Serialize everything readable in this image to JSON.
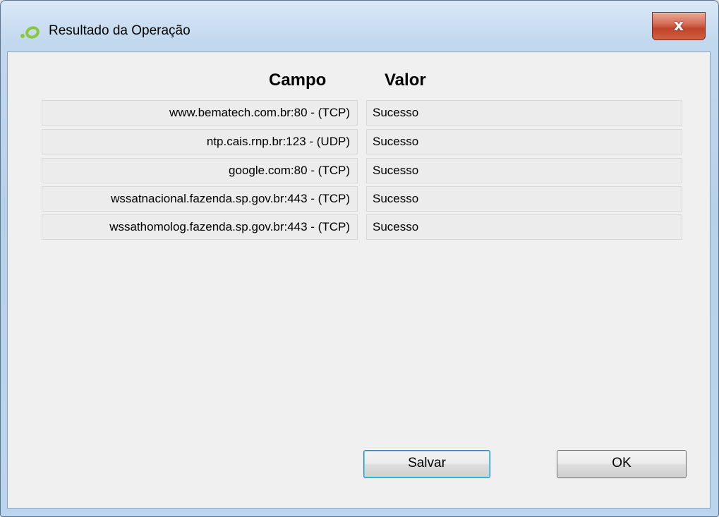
{
  "window": {
    "title": "Resultado da Operação",
    "close_label": "x"
  },
  "table": {
    "headers": {
      "campo": "Campo",
      "valor": "Valor"
    },
    "rows": [
      {
        "campo": "www.bematech.com.br:80 - (TCP)",
        "valor": "Sucesso"
      },
      {
        "campo": "ntp.cais.rnp.br:123 - (UDP)",
        "valor": "Sucesso"
      },
      {
        "campo": "google.com:80 - (TCP)",
        "valor": "Sucesso"
      },
      {
        "campo": "wssatnacional.fazenda.sp.gov.br:443 - (TCP)",
        "valor": "Sucesso"
      },
      {
        "campo": "wssathomolog.fazenda.sp.gov.br:443 - (TCP)",
        "valor": "Sucesso"
      }
    ]
  },
  "buttons": {
    "save_label": "Salvar",
    "ok_label": "OK"
  },
  "colors": {
    "icon_green": "#8cc63f",
    "close_red": "#c0442c",
    "focus_blue": "#3c7fb1"
  },
  "icons": {
    "app": "app-logo-icon",
    "close": "close-icon"
  }
}
